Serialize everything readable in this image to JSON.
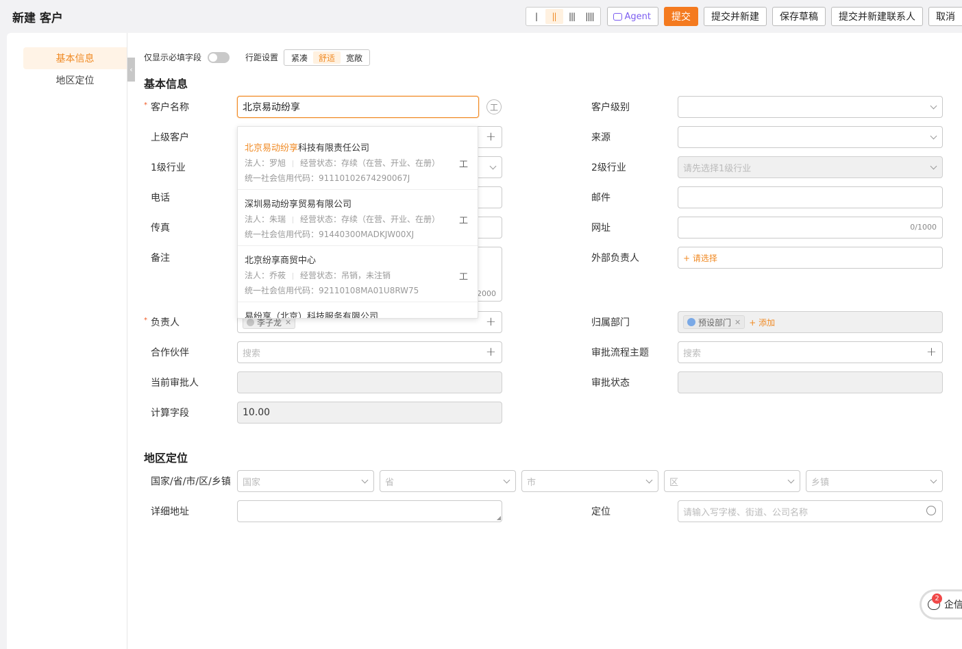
{
  "header": {
    "title": "新建 客户",
    "density_options": [
      "|",
      "||",
      "|||",
      "||||"
    ],
    "agent_label": "Agent",
    "submit_label": "提交",
    "submit_new_label": "提交并新建",
    "save_draft_label": "保存草稿",
    "submit_contact_label": "提交并新建联系人",
    "cancel_label": "取消"
  },
  "sidebar": {
    "items": [
      {
        "label": "基本信息",
        "active": true
      },
      {
        "label": "地区定位",
        "active": false
      }
    ]
  },
  "form_options": {
    "required_only_label": "仅显示必填字段",
    "row_spacing_label": "行距设置",
    "spacing_options": [
      "紧凑",
      "舒适",
      "宽敞"
    ],
    "spacing_selected": "舒适"
  },
  "basic": {
    "section_title": "基本信息",
    "customer_name": {
      "label": "客户名称",
      "value": "北京易动纷享",
      "required": true
    },
    "parent_customer": {
      "label": "上级客户"
    },
    "industry1": {
      "label": "1级行业"
    },
    "phone": {
      "label": "电话"
    },
    "fax": {
      "label": "传真"
    },
    "remark": {
      "label": "备注",
      "counter": "2000"
    },
    "owner": {
      "label": "负责人",
      "tag": "李子龙",
      "required": true
    },
    "partner": {
      "label": "合作伙伴",
      "placeholder": "搜索"
    },
    "current_approver": {
      "label": "当前审批人"
    },
    "calc_field": {
      "label": "计算字段",
      "value": "10.00"
    },
    "customer_level": {
      "label": "客户级别"
    },
    "source": {
      "label": "来源"
    },
    "industry2": {
      "label": "2级行业",
      "placeholder": "请先选择1级行业"
    },
    "email": {
      "label": "邮件"
    },
    "website": {
      "label": "网址",
      "counter": "0/1000"
    },
    "external_owner": {
      "label": "外部负责人",
      "action": "+ 请选择"
    },
    "department": {
      "label": "归属部门",
      "tag": "预设部门",
      "action": "+ 添加"
    },
    "approval_topic": {
      "label": "审批流程主题",
      "placeholder": "搜索"
    },
    "approval_status": {
      "label": "审批状态"
    }
  },
  "suggestions": [
    {
      "highlight": "北京易动纷享",
      "rest": "科技有限责任公司",
      "legal": "法人：罗旭",
      "status": "经营状态：存续（在营、开业、在册）",
      "code": "统一社会信用代码：91110102674290067J"
    },
    {
      "highlight": "",
      "rest": "深圳易动纷享贸易有限公司",
      "legal": "法人：朱瑞",
      "status": "经营状态：存续（在营、开业、在册）",
      "code": "统一社会信用代码：91440300MADKJW00XJ"
    },
    {
      "highlight": "",
      "rest": "北京纷享商贸中心",
      "legal": "法人：乔莜",
      "status": "经营状态：吊销，未注销",
      "code": "统一社会信用代码：92110108MA01U8RW75"
    },
    {
      "highlight": "",
      "rest": "易纷享（北京）科技服务有限公司",
      "legal": "",
      "status": "",
      "code": ""
    }
  ],
  "gongshang_icon_label": "工",
  "region": {
    "section_title": "地区定位",
    "area_label": "国家/省/市/区/乡镇",
    "country_placeholder": "国家",
    "province_placeholder": "省",
    "city_placeholder": "市",
    "district_placeholder": "区",
    "town_placeholder": "乡镇",
    "address_label": "详细地址",
    "location_label": "定位",
    "location_placeholder": "请输入写字楼、街道、公司名称"
  },
  "chat": {
    "badge": "2",
    "label": "企信"
  }
}
